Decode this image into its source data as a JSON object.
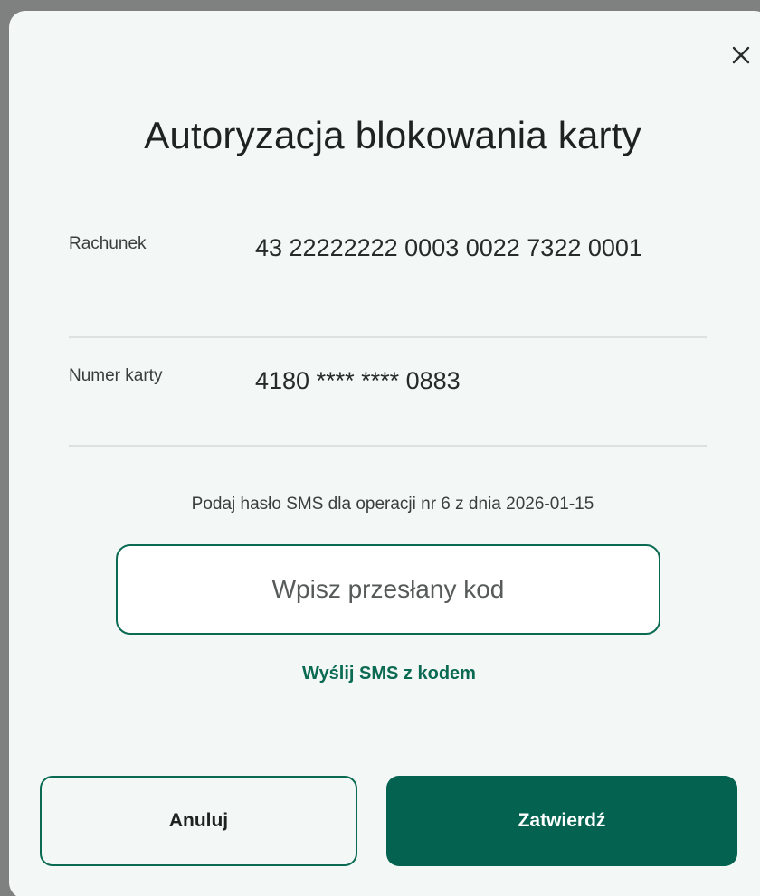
{
  "modal": {
    "title": "Autoryzacja blokowania karty",
    "close_icon": "close-icon"
  },
  "details": {
    "account_label": "Rachunek",
    "account_value": "43 22222222 0003 0022 7322 0001",
    "card_label": "Numer karty",
    "card_value": "4180 **** **** 0883"
  },
  "sms": {
    "instruction": "Podaj hasło SMS dla operacji nr 6 z dnia 2026-01-15",
    "code_placeholder": "Wpisz przesłany kod",
    "code_value": "",
    "send_link": "Wyślij SMS z kodem"
  },
  "actions": {
    "cancel_label": "Anuluj",
    "confirm_label": "Zatwierdź"
  },
  "colors": {
    "accent": "#0a6b52",
    "confirm_bg": "#036350",
    "modal_bg": "#f3f7f5",
    "overlay": "#7f8181"
  }
}
